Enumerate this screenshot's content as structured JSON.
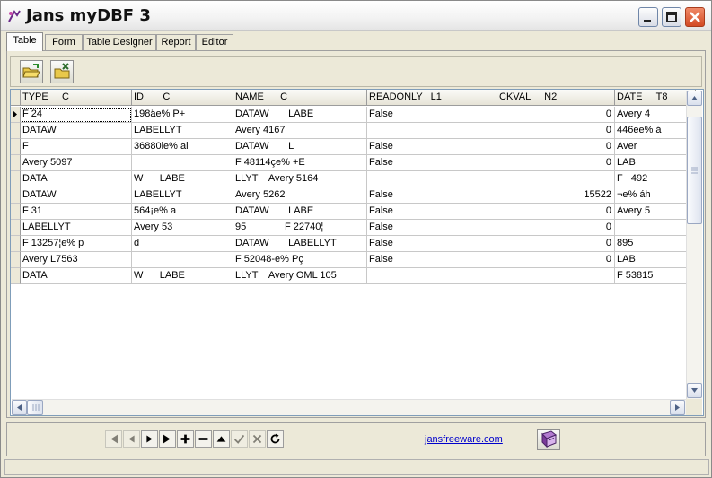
{
  "window": {
    "title": "Jans myDBF 3",
    "controls": [
      "minimize",
      "maximize",
      "close"
    ]
  },
  "tabs": [
    {
      "label": "Table",
      "active": true
    },
    {
      "label": "Form",
      "active": false
    },
    {
      "label": "Table Designer",
      "active": false
    },
    {
      "label": "Report",
      "active": false
    },
    {
      "label": "Editor",
      "active": false
    }
  ],
  "toolbar": {
    "buttons": [
      {
        "icon": "open-folder-icon"
      },
      {
        "icon": "close-folder-icon"
      }
    ]
  },
  "grid": {
    "columns": [
      {
        "name": "TYPE",
        "type": "C",
        "len": ""
      },
      {
        "name": "ID",
        "type": "C",
        "len": ""
      },
      {
        "name": "NAME",
        "type": "C",
        "len": ""
      },
      {
        "name": "READONLY",
        "type": "L",
        "len": "1"
      },
      {
        "name": "CKVAL",
        "type": "N",
        "len": "2"
      },
      {
        "name": "DATE",
        "type": "T",
        "len": "8"
      }
    ],
    "header_labels": [
      "TYPE     C",
      "ID       C",
      "NAME      C",
      "READONLY   L1",
      "CKVAL     N2",
      "DATE     T8"
    ],
    "rows": [
      [
        "F 24",
        "198äe% P+",
        "DATAW       LABE",
        "False",
        "0",
        "Avery 4"
      ],
      [
        "DATAW",
        "LABELLYT",
        "Avery 4167",
        "",
        "0",
        "446ee% á"
      ],
      [
        "F",
        "36880ie% al",
        "DATAW       L",
        "False",
        "0",
        "Aver"
      ],
      [
        "Avery 5097",
        "",
        "F 48114çe% +E",
        "False",
        "0",
        "LAB"
      ],
      [
        "DATA",
        "W      LABE",
        "LLYT    Avery 5164",
        "",
        "",
        "F   492"
      ],
      [
        "DATAW",
        "LABELLYT",
        "Avery 5262",
        "False",
        "15522",
        "¬e% áh"
      ],
      [
        "F 31",
        "564¡e% a",
        "DATAW       LABE",
        "False",
        "0",
        "Avery 5"
      ],
      [
        "LABELLYT",
        "Avery 53",
        "95              F 22740¦",
        "False",
        "0",
        ""
      ],
      [
        "F 13257¦e% p",
        "d",
        "DATAW       LABELLYT",
        "False",
        "0",
        "895"
      ],
      [
        "Avery L7563",
        "",
        "F 52048-e% Pç",
        "False",
        "0",
        "LAB"
      ],
      [
        "DATA",
        "W      LABE",
        "LLYT    Avery OML 105",
        "",
        "",
        "F 53815"
      ]
    ],
    "current_row": 0
  },
  "navigator": {
    "buttons": [
      {
        "icon": "first-record-icon",
        "enabled": false
      },
      {
        "icon": "prior-record-icon",
        "enabled": false
      },
      {
        "icon": "next-record-icon",
        "enabled": true
      },
      {
        "icon": "last-record-icon",
        "enabled": true
      },
      {
        "icon": "insert-record-icon",
        "enabled": true
      },
      {
        "icon": "delete-record-icon",
        "enabled": true
      },
      {
        "icon": "edit-record-icon",
        "enabled": true
      },
      {
        "icon": "post-edit-icon",
        "enabled": false
      },
      {
        "icon": "cancel-edit-icon",
        "enabled": false
      },
      {
        "icon": "refresh-icon",
        "enabled": true
      }
    ],
    "link": "jansfreeware.com",
    "help_icon": "book-icon"
  },
  "colors": {
    "window_bg": "#ece9d8",
    "close_button": "#d34a24",
    "link": "#0000cc",
    "grid_border": "#7f9db9"
  }
}
